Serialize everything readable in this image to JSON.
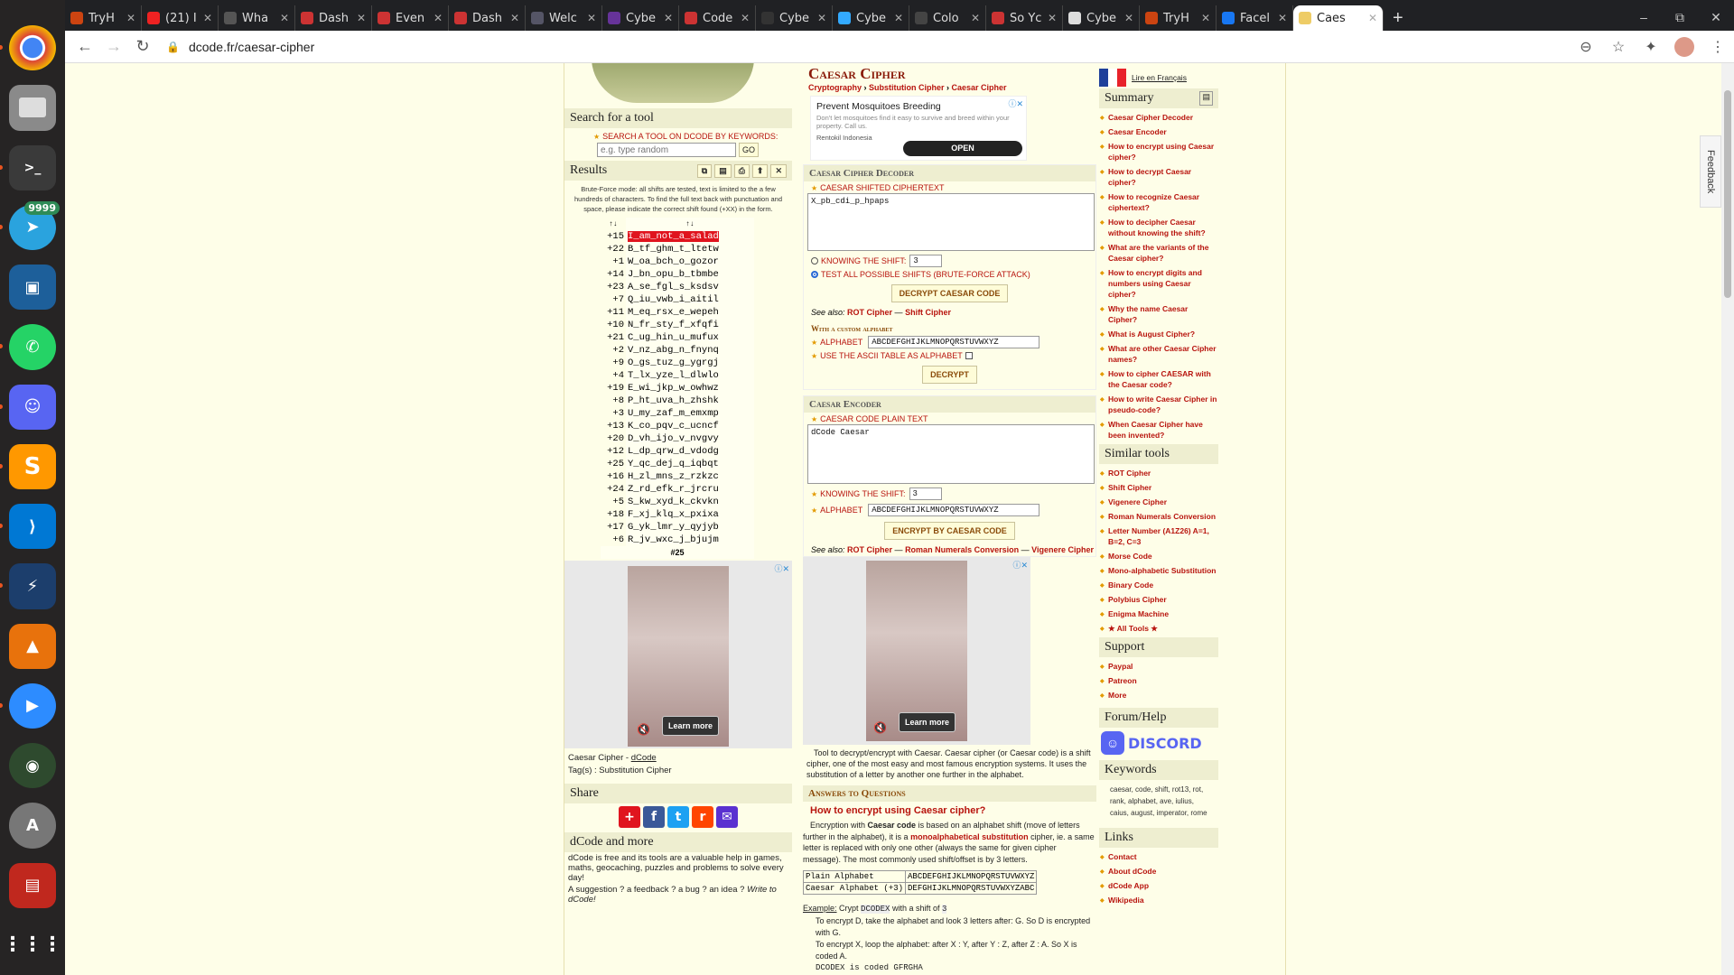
{
  "dock": {
    "telegram_badge": "9999",
    "items": [
      "chrome",
      "files",
      "terminal",
      "telegram",
      "virtualbox",
      "whatsapp",
      "discord",
      "sublime",
      "vscode",
      "kali-launcher",
      "vlc",
      "zoom",
      "camera",
      "software-center",
      "pdf-reader",
      "apps-grid"
    ]
  },
  "tabs": [
    {
      "label": "TryH",
      "color": "#c41"
    },
    {
      "label": "(21) I",
      "color": "#e22"
    },
    {
      "label": "Wha",
      "color": "#555"
    },
    {
      "label": "Dash",
      "color": "#c33"
    },
    {
      "label": "Even",
      "color": "#c33"
    },
    {
      "label": "Dash",
      "color": "#c33"
    },
    {
      "label": "Welc",
      "color": "#556"
    },
    {
      "label": "Cybe",
      "color": "#639"
    },
    {
      "label": "Code",
      "color": "#c33"
    },
    {
      "label": "Cybe",
      "color": "#333"
    },
    {
      "label": "Cybe",
      "color": "#3af"
    },
    {
      "label": "Colo",
      "color": "#444"
    },
    {
      "label": "So Yc",
      "color": "#c33"
    },
    {
      "label": "Cybe",
      "color": "#ddd"
    },
    {
      "label": "TryH",
      "color": "#c41"
    },
    {
      "label": "Facel",
      "color": "#1877f2"
    },
    {
      "label": "Caes",
      "color": "#ec6"
    }
  ],
  "window": {
    "minimize": "–",
    "maximize": "⧉",
    "close": "✕",
    "new_tab": "+"
  },
  "address": {
    "url": "dcode.fr/caesar-cipher"
  },
  "feedback": "Feedback",
  "left": {
    "search_title": "Search for a tool",
    "search_label": "SEARCH A TOOL ON DCODE BY KEYWORDS:",
    "search_placeholder": "e.g. type random",
    "go": "GO",
    "results_title": "Results",
    "results_note": "Brute-Force mode: all shifts are tested, text is limited to the a few hundreds of characters. To find the full text back with punctuation and space, please indicate the correct shift found (+XX) in the form.",
    "sort1": "↑↓",
    "sort2": "↑↓",
    "rows": [
      [
        "+15",
        "I_am_not_a_salad"
      ],
      [
        "+22",
        "B_tf_ghm_t_ltetw"
      ],
      [
        "+1",
        "W_oa_bch_o_gozor"
      ],
      [
        "+14",
        "J_bn_opu_b_tbmbe"
      ],
      [
        "+23",
        "A_se_fgl_s_ksdsv"
      ],
      [
        "+7",
        "Q_iu_vwb_i_aitil"
      ],
      [
        "+11",
        "M_eq_rsx_e_wepeh"
      ],
      [
        "+10",
        "N_fr_sty_f_xfqfi"
      ],
      [
        "+21",
        "C_ug_hin_u_mufux"
      ],
      [
        "+2",
        "V_nz_abg_n_fnynq"
      ],
      [
        "+9",
        "O_gs_tuz_g_ygrgj"
      ],
      [
        "+4",
        "T_lx_yze_l_dlwlo"
      ],
      [
        "+19",
        "E_wi_jkp_w_owhwz"
      ],
      [
        "+8",
        "P_ht_uva_h_zhshk"
      ],
      [
        "+3",
        "U_my_zaf_m_emxmp"
      ],
      [
        "+13",
        "K_co_pqv_c_ucncf"
      ],
      [
        "+20",
        "D_vh_ijo_v_nvgvy"
      ],
      [
        "+12",
        "L_dp_qrw_d_vdodg"
      ],
      [
        "+25",
        "Y_qc_dej_q_iqbqt"
      ],
      [
        "+16",
        "H_zl_mns_z_rzkzc"
      ],
      [
        "+24",
        "Z_rd_efk_r_jrcru"
      ],
      [
        "+5",
        "S_kw_xyd_k_ckvkn"
      ],
      [
        "+18",
        "F_xj_klq_x_pxixa"
      ],
      [
        "+17",
        "G_yk_lmr_y_qyjyb"
      ],
      [
        "+6",
        "R_jv_wxc_j_bjujm"
      ]
    ],
    "footer": "#25",
    "ad_learn": "Learn more",
    "page_name": "Caesar Cipher - ",
    "dcode_link": "dCode",
    "tags": "Tag(s) : Substitution Cipher",
    "share_title": "Share",
    "more_title": "dCode and more",
    "more_text": "dCode is free and its tools are a valuable help in games, maths, geocaching, puzzles and problems to solve every day!",
    "suggest": "A suggestion ? a feedback ? a bug ? an idea ? ",
    "write": "Write to dCode!"
  },
  "main": {
    "title": "Caesar Cipher",
    "bc1": "Cryptography",
    "bc2": "Substitution Cipher",
    "bc3": "Caesar Cipher",
    "bc_sep": " › ",
    "ad_title": "Prevent Mosquitoes Breeding",
    "ad_text": "Don't let mosquitoes find it easy to survive and breed within your property. Call us.",
    "ad_brand": "Rentokil Indonesia",
    "ad_open": "OPEN",
    "decoder_title": "Caesar Cipher Decoder",
    "cipher_label": "CAESAR SHIFTED CIPHERTEXT",
    "cipher_value": "X_pb_cdi_p_hpaps",
    "knowing": "KNOWING THE SHIFT:",
    "shift_val": "3",
    "test_all": "TEST ALL POSSIBLE SHIFTS (BRUTE-FORCE ATTACK)",
    "decrypt_btn": "DECRYPT CAESAR CODE",
    "see_also": "See also: ",
    "rot": "ROT Cipher",
    "dash": " — ",
    "shift": "Shift Cipher",
    "custom_alpha": "With a custom alphabet",
    "alpha_label": "ALPHABET",
    "alpha_value": "ABCDEFGHIJKLMNOPQRSTUVWXYZ",
    "ascii_label": "USE THE ASCII TABLE AS ALPHABET",
    "decrypt": "DECRYPT",
    "encoder_title": "Caesar Encoder",
    "plain_label": "CAESAR CODE PLAIN TEXT",
    "plain_value": "dCode Caesar",
    "knowing2": "KNOWING THE SHIFT:",
    "shift_val2": "3",
    "alpha_label2": "ALPHABET",
    "alpha_value2": "ABCDEFGHIJKLMNOPQRSTUVWXYZ",
    "encrypt_btn": "ENCRYPT BY CAESAR CODE",
    "see_also2": "See also: ",
    "rot2": "ROT Cipher",
    "roman": "Roman Numerals Conversion",
    "vig": "Vigenere Cipher",
    "ad_learn2": "Learn more",
    "desc": "Tool to decrypt/encrypt with Caesar. Caesar cipher (or Caesar code) is a shift cipher, one of the most easy and most famous encryption systems. It uses the substitution of a letter by another one further in the alphabet.",
    "answers": "Answers to Questions",
    "q1": "How to encrypt using Caesar cipher?",
    "a1_1": "Encryption with ",
    "a1_2": "Caesar code",
    "a1_3": " is based on an alphabet shift (move of letters further in the alphabet), it is a ",
    "a1_4": "monoalphabetical substitution",
    "a1_5": " cipher, ie. a same letter is replaced with only one other (always the same for given cipher message). The most commonly used shift/offset is by 3 letters.",
    "t_plain": "Plain Alphabet",
    "t_plain_v": "ABCDEFGHIJKLMNOPQRSTUVWXYZ",
    "t_caesar": "Caesar Alphabet (+3)",
    "t_caesar_v": "DEFGHIJKLMNOPQRSTUVWXYZABC",
    "ex_label": "Example:",
    "ex1": " Crypt ",
    "ex_dc": "DCODEX",
    "ex2": " with a shift of ",
    "ex_3": "3",
    "ex3": "To encrypt D, take the alphabet and look 3 letters after: G. So D is encrypted with G.",
    "ex4": "To encrypt X, loop the alphabet: after X : Y, after Y : Z, after Z : A. So X is coded A.",
    "ex5": "DCODEX is coded GFRGHA"
  },
  "right": {
    "lang": "Lire en Français",
    "summary": "Summary",
    "summary_items": [
      "Caesar Cipher Decoder",
      "Caesar Encoder",
      "How to encrypt using Caesar cipher?",
      "How to decrypt Caesar cipher?",
      "How to recognize Caesar ciphertext?",
      "How to decipher Caesar without knowing the shift?",
      "What are the variants of the Caesar cipher?",
      "How to encrypt digits and numbers using Caesar cipher?",
      "Why the name Caesar Cipher?",
      "What is August Cipher?",
      "What are other Caesar Cipher names?",
      "How to cipher CAESAR with the Caesar code?",
      "How to write Caesar Cipher in pseudo-code?",
      "When Caesar Cipher have been invented?"
    ],
    "similar": "Similar tools",
    "similar_items": [
      "ROT Cipher",
      "Shift Cipher",
      "Vigenere Cipher",
      "Roman Numerals Conversion",
      "Letter Number (A1Z26) A=1, B=2, C=3",
      "Morse Code",
      "Mono-alphabetic Substitution",
      "Binary Code",
      "Polybius Cipher",
      "Enigma Machine",
      "★ All Tools ★"
    ],
    "support": "Support",
    "support_items": [
      "Paypal",
      "Patreon",
      "More"
    ],
    "forum": "Forum/Help",
    "discord": "DISCORD",
    "keywords": "Keywords",
    "keywords_text": "caesar, code, shift, rot13, rot, rank, alphabet, ave, iulius, caius, august, imperator, rome",
    "links": "Links",
    "links_items": [
      "Contact",
      "About dCode",
      "dCode App",
      "Wikipedia"
    ]
  }
}
